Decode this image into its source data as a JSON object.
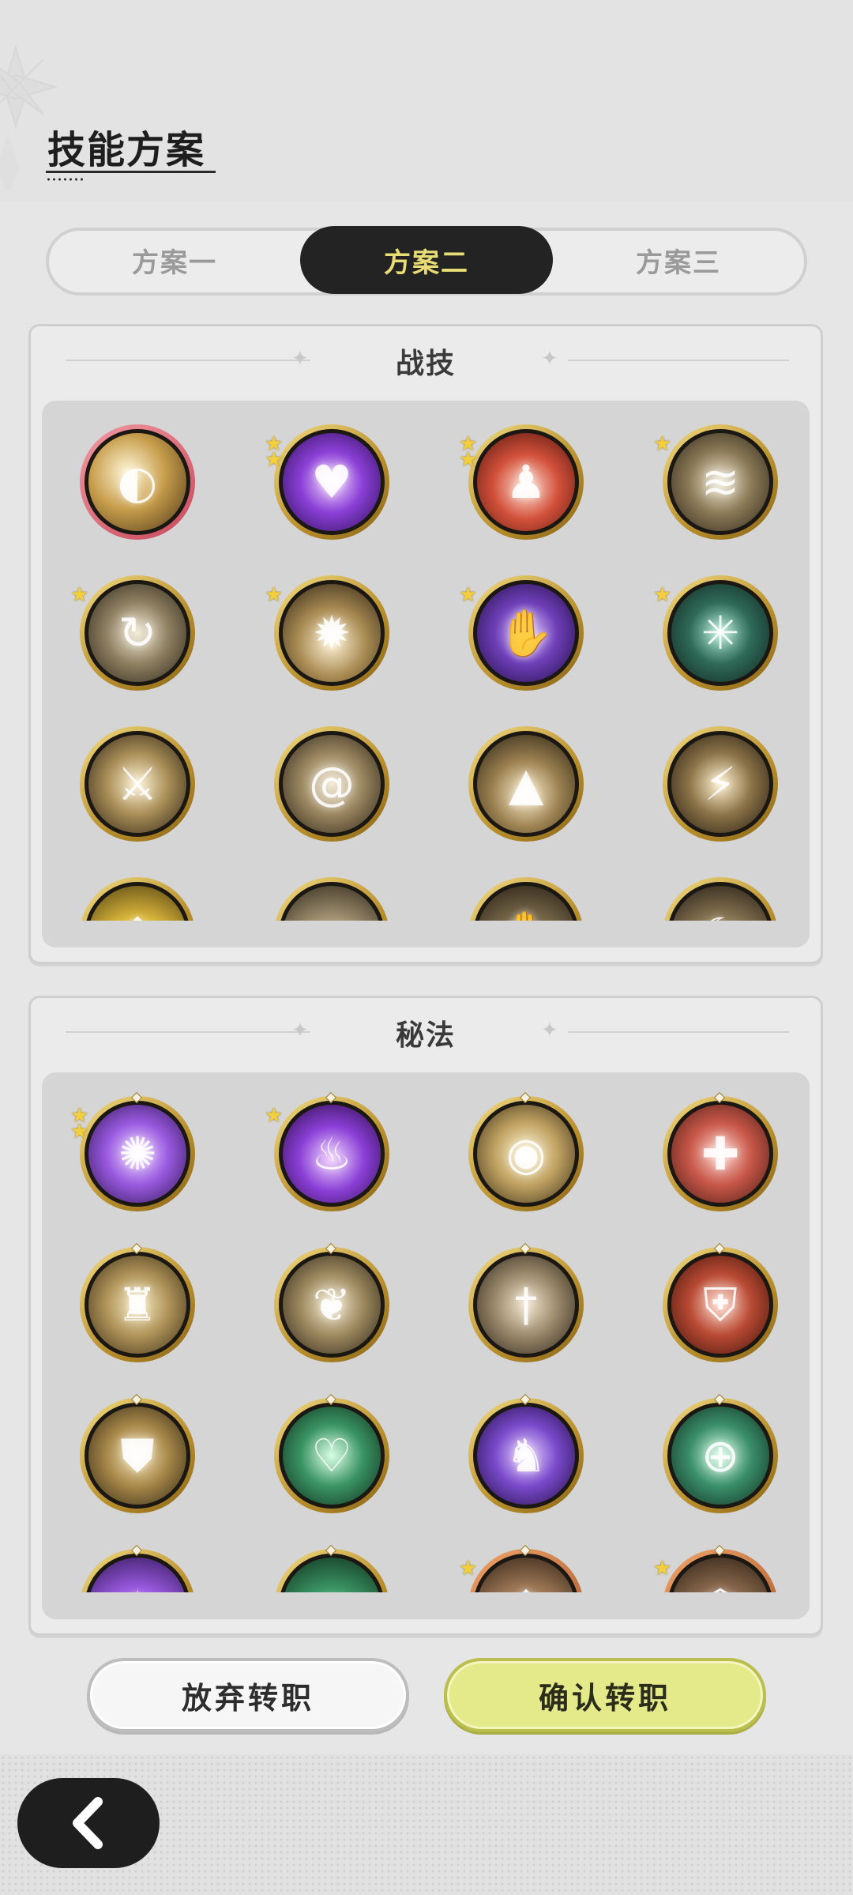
{
  "header": {
    "title": "技能方案"
  },
  "tabs": [
    {
      "label": "方案一",
      "active": false
    },
    {
      "label": "方案二",
      "active": true
    },
    {
      "label": "方案三",
      "active": false
    }
  ],
  "sections": {
    "combat": {
      "title": "战技",
      "skills": [
        {
          "icon": "golden-slash-swirl-icon",
          "stars": 0,
          "frame": "rose"
        },
        {
          "icon": "purple-heart-burst-icon",
          "stars": 2,
          "frame": "gold"
        },
        {
          "icon": "red-sword-figure-icon",
          "stars": 2,
          "frame": "gold"
        },
        {
          "icon": "wind-slash-icon",
          "stars": 1,
          "frame": "gold"
        },
        {
          "icon": "whirlwind-icon",
          "stars": 1,
          "frame": "gold"
        },
        {
          "icon": "ground-burst-icon",
          "stars": 1,
          "frame": "gold"
        },
        {
          "icon": "purple-claw-icon",
          "stars": 1,
          "frame": "gold"
        },
        {
          "icon": "green-web-icon",
          "stars": 1,
          "frame": "gold"
        },
        {
          "icon": "sword-strike-icon",
          "stars": 0,
          "frame": "gold"
        },
        {
          "icon": "spiral-wind-icon",
          "stars": 0,
          "frame": "gold"
        },
        {
          "icon": "spike-eruption-icon",
          "stars": 0,
          "frame": "gold"
        },
        {
          "icon": "lightning-slash-icon",
          "stars": 0,
          "frame": "gold"
        },
        {
          "icon": "radiant-arrow-icon",
          "stars": 0,
          "frame": "gold"
        },
        {
          "icon": "dust-cloud-icon",
          "stars": 0,
          "frame": "gold"
        },
        {
          "icon": "shadow-hand-icon",
          "stars": 0,
          "frame": "gold"
        },
        {
          "icon": "crescent-wave-icon",
          "stars": 0,
          "frame": "gold"
        }
      ]
    },
    "arcane": {
      "title": "秘法",
      "skills": [
        {
          "icon": "purple-orb-icon",
          "stars": 2,
          "frame": "gold"
        },
        {
          "icon": "purple-flame-icon",
          "stars": 1,
          "frame": "gold"
        },
        {
          "icon": "all-seeing-eye-icon",
          "stars": 0,
          "frame": "gold"
        },
        {
          "icon": "red-sword-plus-icon",
          "stars": 0,
          "frame": "gold"
        },
        {
          "icon": "golden-guardian-icon",
          "stars": 0,
          "frame": "gold"
        },
        {
          "icon": "leaf-moon-icon",
          "stars": 0,
          "frame": "gold"
        },
        {
          "icon": "dagger-icon",
          "stars": 0,
          "frame": "gold"
        },
        {
          "icon": "red-shield-icon",
          "stars": 0,
          "frame": "gold"
        },
        {
          "icon": "armor-icon",
          "stars": 0,
          "frame": "gold"
        },
        {
          "icon": "green-heart-heal-icon",
          "stars": 0,
          "frame": "gold"
        },
        {
          "icon": "purple-beast-icon",
          "stars": 0,
          "frame": "gold"
        },
        {
          "icon": "green-healing-circle-icon",
          "stars": 0,
          "frame": "gold"
        },
        {
          "icon": "purple-light-icon",
          "stars": 0,
          "frame": "gold"
        },
        {
          "icon": "green-leaf-icon",
          "stars": 0,
          "frame": "gold"
        },
        {
          "icon": "copper-scroll-icon",
          "stars": 1,
          "frame": "copper"
        },
        {
          "icon": "copper-emblem-icon",
          "stars": 1,
          "frame": "copper"
        }
      ]
    }
  },
  "buttons": {
    "abandon_label": "放弃转职",
    "confirm_label": "确认转职"
  },
  "colors": {
    "accent": "#e8dc74",
    "confirm_bg": "#e4ea8a",
    "tab_active_bg": "#232323"
  }
}
